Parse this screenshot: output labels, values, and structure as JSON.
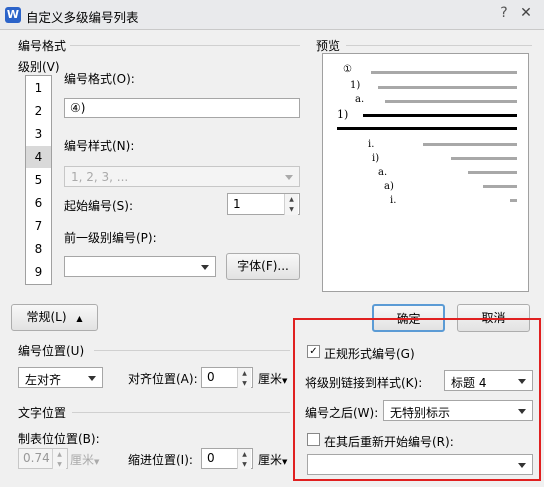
{
  "window": {
    "title": "自定义多级编号列表",
    "help_label": "?",
    "close_label": "✕",
    "app_icon_label": "W"
  },
  "number_format_section": {
    "legend": "编号格式",
    "level_label": "级别(V)",
    "levels": [
      "1",
      "2",
      "3",
      "4",
      "5",
      "6",
      "7",
      "8",
      "9"
    ],
    "selected_level": "4",
    "format_label": "编号格式(O):",
    "format_value": "④)",
    "style_label": "编号样式(N):",
    "style_value": "1, 2, 3, ...",
    "start_label": "起始编号(S):",
    "start_value": "1",
    "prev_level_label": "前一级别编号(P):",
    "prev_level_value": "",
    "font_button": "字体(F)..."
  },
  "preview_section": {
    "legend": "预览",
    "lines": [
      "①",
      "1)",
      "a.",
      "1)",
      "i.",
      "i)",
      "a.",
      "a)",
      "i."
    ]
  },
  "buttons": {
    "normal": "常规(L)",
    "ok": "确定",
    "cancel": "取消"
  },
  "position_section": {
    "legend": "编号位置(U)",
    "align_value": "左对齐",
    "align_pos_label": "对齐位置(A):",
    "align_pos_value": "0",
    "unit": "厘米"
  },
  "text_position_section": {
    "legend": "文字位置",
    "tab_label": "制表位位置(B):",
    "tab_value": "0.74",
    "indent_label": "缩进位置(I):",
    "indent_value": "0",
    "unit": "厘米"
  },
  "advanced": {
    "legal_numbering_label": "正规形式编号(G)",
    "legal_numbering_checked": true,
    "link_style_label": "将级别链接到样式(K):",
    "link_style_value": "标题 4",
    "follow_label": "编号之后(W):",
    "follow_value": "无特别标示",
    "restart_label": "在其后重新开始编号(R):",
    "restart_checked": false,
    "restart_value": ""
  },
  "colors": {
    "highlight_box": "#e02020",
    "accent": "#2b63c9"
  }
}
